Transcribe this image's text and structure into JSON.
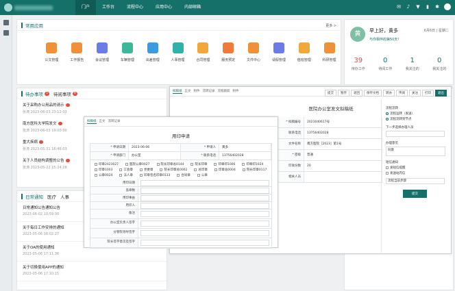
{
  "nav": {
    "items": [
      "门户",
      "工作台",
      "流程中心",
      "应用中心",
      "内部邮箱"
    ],
    "active": 0
  },
  "apps": {
    "title": "常用应用",
    "more": "更多 >",
    "items": [
      {
        "label": "公文管理",
        "color": "#f0913a"
      },
      {
        "label": "工作报告",
        "color": "#f0913a"
      },
      {
        "label": "会议管理",
        "color": "#6b7be8"
      },
      {
        "label": "车辆管理",
        "color": "#3bb89a"
      },
      {
        "label": "出差管理",
        "color": "#3b9be0"
      },
      {
        "label": "人事管理",
        "color": "#2fb3a8"
      },
      {
        "label": "合同管理",
        "color": "#f0a83a"
      },
      {
        "label": "服务预定",
        "color": "#f07a3a"
      },
      {
        "label": "文件中心",
        "color": "#f0913a"
      },
      {
        "label": "请假管理",
        "color": "#6b7be8"
      },
      {
        "label": "值班管理",
        "color": "#f0a83a"
      },
      {
        "label": "科研管理",
        "color": "#f0913a"
      }
    ]
  },
  "todo": {
    "tabs": [
      {
        "label": "待办事项",
        "count": "5"
      },
      {
        "label": "待阅事项",
        "count": "9"
      }
    ],
    "items": [
      {
        "title": "关于采购办公用品的请示",
        "meta": "张涛  2023-06-03 23:12:03"
      },
      {
        "title": "南方医科大学院发文",
        "meta": "张涛  2023-06-03 19:00:00"
      },
      {
        "title": "重大疾病",
        "meta": "张涛  2023-05-31 16:46:03"
      },
      {
        "title": "关于人员结构调整的公告",
        "meta": "张涛  2023-05-22 15:24:28"
      }
    ]
  },
  "notices": {
    "tabs": [
      "日常通知",
      "医疗",
      "人事"
    ],
    "items": [
      {
        "title": "日常通知公告通知公告",
        "meta": "2023-06-02 10:59:00"
      },
      {
        "title": "关于每日工作安排的通知",
        "meta": "2023-05-06 08:02:27"
      },
      {
        "title": "关于OA的使用通知",
        "meta": "2023-05-06 17:11:36"
      },
      {
        "title": "关于切换使用APP的通知",
        "meta": "2023-05-06 17:10:15"
      }
    ]
  },
  "user": {
    "avatar": "黄",
    "greeting": "早上好，黄多",
    "sub": "与你相伴的第50天！",
    "date": "6月6日 | 星期二",
    "stats": [
      {
        "n": "39",
        "l": "待办工作"
      },
      {
        "n": "0",
        "l": "待阅工作"
      },
      {
        "n": "1",
        "l": "我关注的"
      },
      {
        "n": "0",
        "l": "我关注的"
      }
    ]
  },
  "doc": {
    "title": "医院办公室发文拟稿纸",
    "tabs": [
      "拟稿纸",
      "正文",
      "附件",
      "流转记录",
      "流程跟踪",
      "附件"
    ],
    "buttons": [
      "提交",
      "暂存",
      "退回",
      "保存文档",
      "转办",
      "传阅",
      "关注",
      "打印",
      "退出"
    ],
    "fields": [
      {
        "label": "* 拟稿编号",
        "value": "2023040617号"
      },
      {
        "label": "联系电话",
        "value": "13756402028"
      },
      {
        "label": "文件名称",
        "value": "南方医院［2023］第1号"
      },
      {
        "label": "* 密级",
        "value": "普通"
      },
      {
        "label": "印发份数",
        "value": "20"
      },
      {
        "label": "相关人员",
        "value": ""
      }
    ]
  },
  "leave": {
    "tabs": [
      "拟稿纸",
      "正文",
      "流转记录"
    ],
    "title": "用印申请",
    "fields": [
      {
        "label": "* 申请日期",
        "value": "2023-06-06"
      },
      {
        "label": "* 申请部门",
        "value": "办公室"
      },
      {
        "label": "* 申请人",
        "value": "黄多"
      },
      {
        "label": "* 联系电话",
        "value": "13756402028"
      }
    ],
    "checks": [
      "印章2023027",
      "医院公章0027",
      "院长印章总0144",
      "院长印章",
      "印章印1006",
      "印章印1024",
      "印章1003",
      "工会章",
      "党委章",
      "院长印章总0002",
      "总印章",
      "印章总0004",
      "院长印章0117",
      "公章0024",
      "法人章",
      "印章签名印章0133",
      "合同章",
      "公章"
    ],
    "fields2": [
      "用印日期",
      "盖章数",
      "用印事由",
      "用印人",
      "备注",
      "办公室负责人签字",
      "分管院领导签字",
      "院长签字意见及签字"
    ]
  },
  "right_panel": {
    "buttons": [
      "提交",
      "暂存"
    ],
    "sections": [
      "流程流转",
      "下一步选择办理人员",
      "办理意见",
      "短信通知"
    ],
    "radios": [
      "流程运转（发送）",
      "流程流转到节点"
    ],
    "options": [
      "发短信提醒",
      "发送站内信"
    ],
    "select": "流程当前步骤",
    "opinion": "同意"
  }
}
